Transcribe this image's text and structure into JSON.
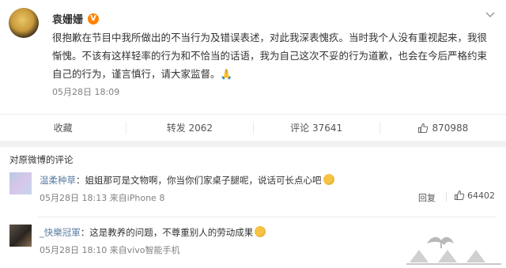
{
  "post": {
    "author": "袁姗姗",
    "text": "很抱歉在节目中我所做出的不当行为及错误表述，对此我深表愧疚。当时我个人没有重视起来，我很惭愧。不该有这样轻率的行为和不恰当的话语，我为自己这次不妥的行为道歉，也会在今后严格约束自己的行为，谨言慎行，请大家监督。🙏",
    "time": "05月28日 18:09",
    "actions": {
      "favorite": "收藏",
      "repost": "转发 2062",
      "comment": "评论 37641",
      "like": "870988"
    }
  },
  "comments_section": {
    "title": "对原微博的评论",
    "comments": [
      {
        "user": "温柔种草",
        "text": "：姐姐那可是文物啊，你当你们家桌子腿呢，说话可长点心吧",
        "meta": "05月28日 18:13 来自iPhone 8",
        "reply": "回复",
        "likes": "64402"
      },
      {
        "user": "_快樂冠軍",
        "text": "：这是教养的问题，不尊重别人的劳动成果",
        "meta": "05月28日 18:10 来自vivo智能手机"
      }
    ]
  },
  "colors": {
    "link": "#5b7ca3",
    "vip": "#ff8200"
  },
  "icons": [
    "vip-icon",
    "menu-chevron-icon",
    "thumb-up-icon",
    "emoji-icon",
    "watermark-logo"
  ]
}
